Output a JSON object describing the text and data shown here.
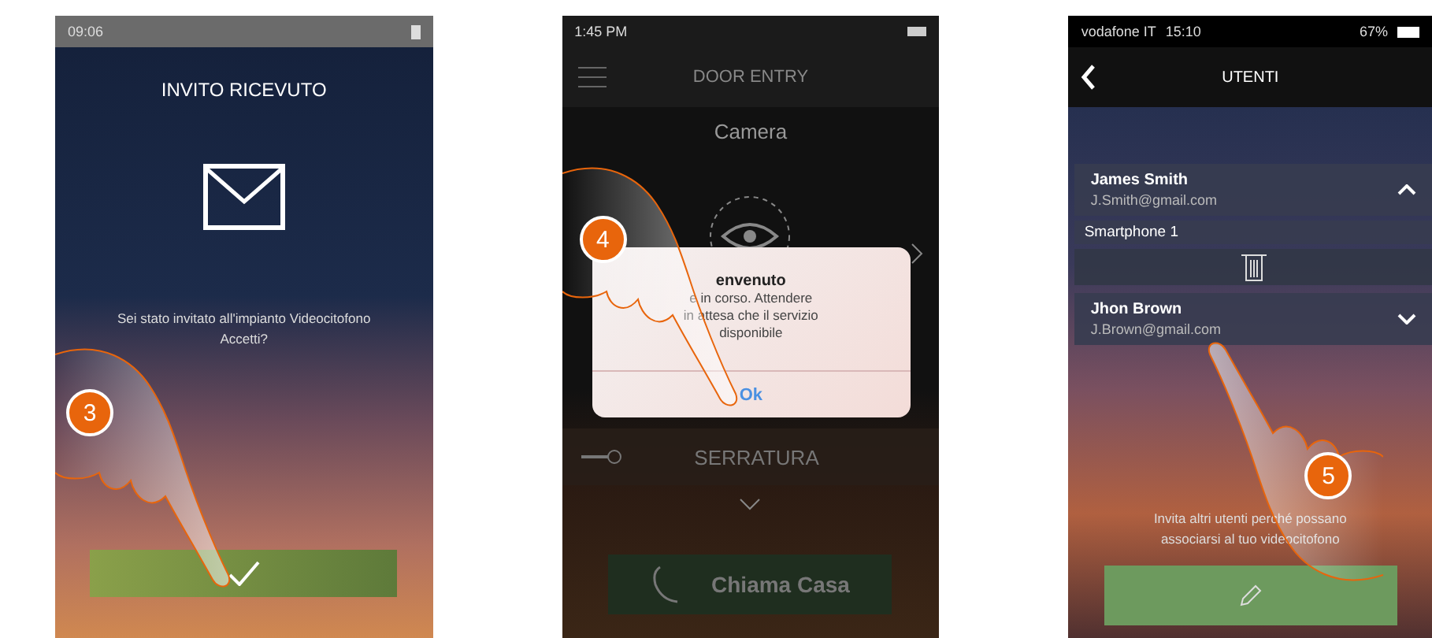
{
  "screens": [
    {
      "kind": "invite",
      "status_bar": {
        "time": "09:06"
      },
      "title": "INVITO RICEVUTO",
      "message": "Sei stato invitato all'impianto Videocitofono",
      "question": "Accetti?",
      "step": "3"
    },
    {
      "kind": "door",
      "status_bar": {
        "time": "1:45 PM"
      },
      "title": "DOOR ENTRY",
      "camera_label": "Camera",
      "dialog": {
        "title": "envenuto",
        "lines": [
          "e in corso. Attendere",
          "in attesa che il servizio",
          "disponibile"
        ],
        "button": "Ok"
      },
      "lock_label": "SERRATURA",
      "call_button": "Chiama Casa",
      "step": "4"
    },
    {
      "kind": "users",
      "status_bar": {
        "carrier": "vodafone IT",
        "time": "15:10",
        "battery": "67%"
      },
      "title": "UTENTI",
      "users": [
        {
          "name": "James Smith",
          "email": "J.Smith@gmail.com",
          "expanded": true,
          "devices": [
            "Smartphone 1"
          ]
        },
        {
          "name": "Jhon Brown",
          "email": "J.Brown@gmail.com",
          "expanded": false
        }
      ],
      "invite_text": "Invita altri utenti perché possano associarsi al tuo videocitofono",
      "step": "5"
    }
  ]
}
